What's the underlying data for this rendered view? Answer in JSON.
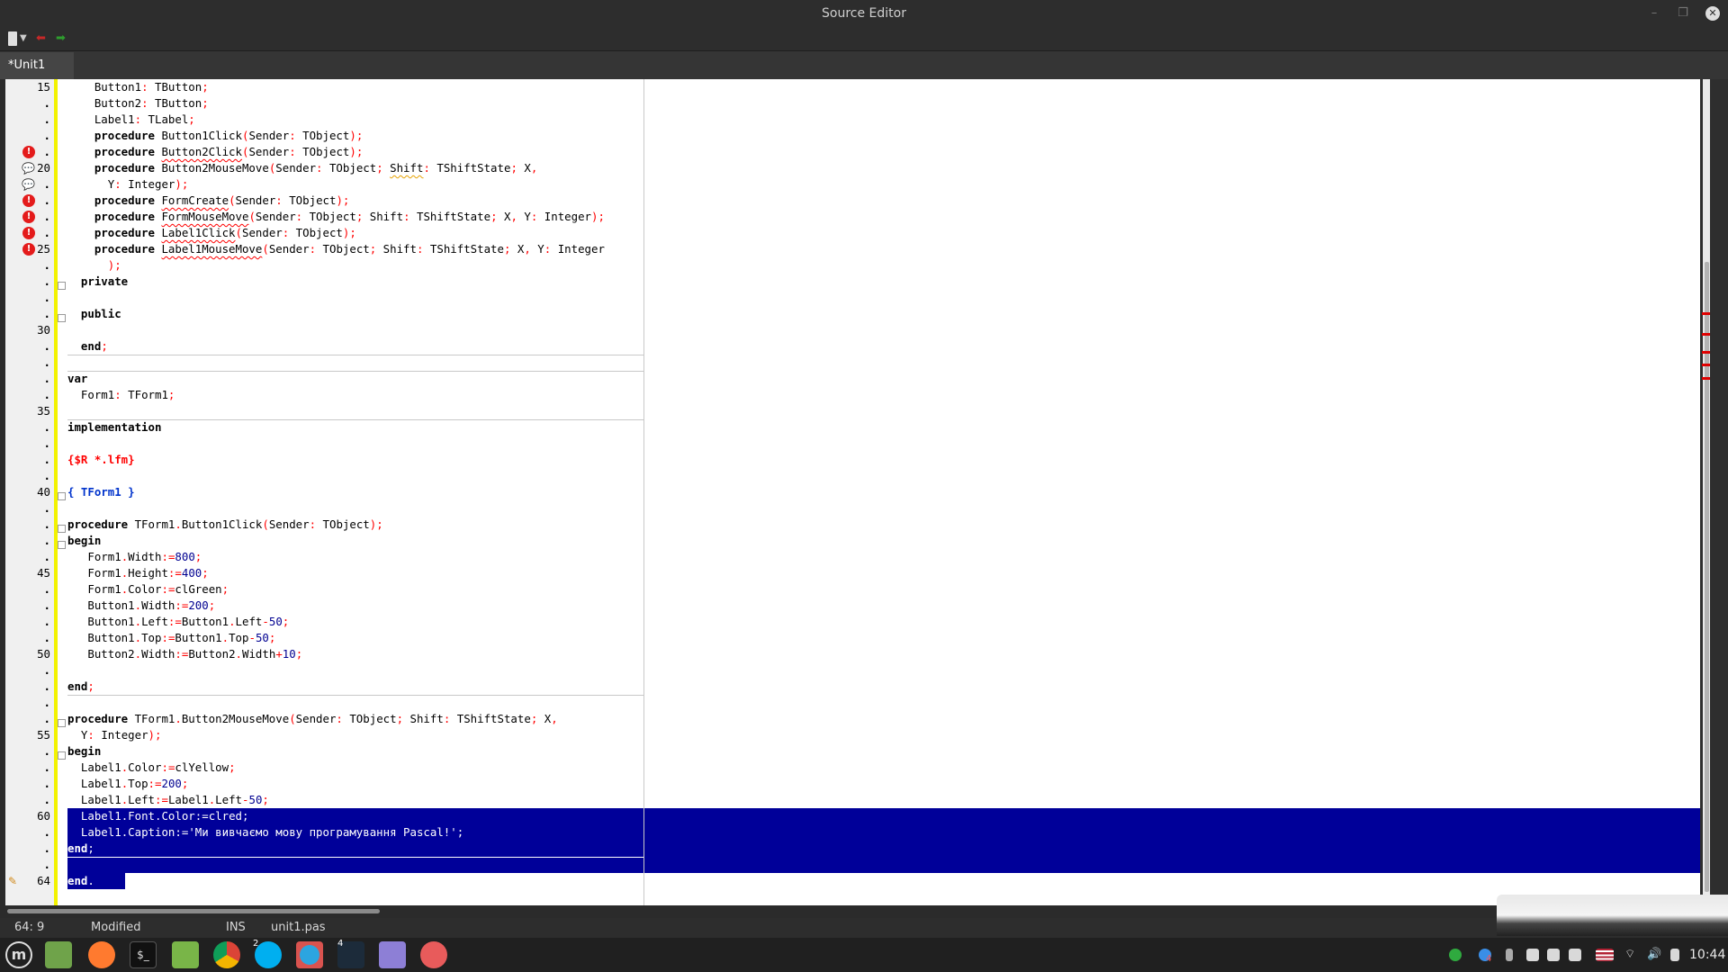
{
  "window": {
    "title": "Source Editor"
  },
  "tabs": [
    {
      "label": "*Unit1",
      "active": true
    }
  ],
  "status": {
    "cursor": "64:  9",
    "state": "Modified",
    "mode": "INS",
    "file": "unit1.pas"
  },
  "taskbar": {
    "clock": "10:44",
    "skype_badge": "2",
    "paw_badge": "4",
    "chrome_badge": "4"
  },
  "colors": {
    "selection": "#000099",
    "keyword": "#000000",
    "symbol": "#ff0000",
    "number": "#000090",
    "directive": "#ff0000",
    "comment": "#0033cc",
    "change_bar": "#f2f200"
  },
  "editor": {
    "lines": [
      {
        "num": "15",
        "text": "    Button1: TButton;"
      },
      {
        "num": ".",
        "text": "    Button2: TButton;"
      },
      {
        "num": ".",
        "text": "    Label1: TLabel;"
      },
      {
        "num": ".",
        "text": "    procedure Button1Click(Sender: TObject);"
      },
      {
        "num": ".",
        "text": "    procedure Button2Click(Sender: TObject);",
        "icon": "error-icon"
      },
      {
        "num": "20",
        "text": "    procedure Button2MouseMove(Sender: TObject; Shift: TShiftState; X,",
        "icon": "hint-icon"
      },
      {
        "num": ".",
        "text": "      Y: Integer);",
        "icon": "hint-icon"
      },
      {
        "num": ".",
        "text": "    procedure FormCreate(Sender: TObject);",
        "icon": "error-icon"
      },
      {
        "num": ".",
        "text": "    procedure FormMouseMove(Sender: TObject; Shift: TShiftState; X, Y: Integer);",
        "icon": "error-icon"
      },
      {
        "num": ".",
        "text": "    procedure Label1Click(Sender: TObject);",
        "icon": "error-icon"
      },
      {
        "num": "25",
        "text": "    procedure Label1MouseMove(Sender: TObject; Shift: TShiftState; X, Y: Integer",
        "icon": "error-icon"
      },
      {
        "num": ".",
        "text": "      );"
      },
      {
        "num": ".",
        "text": "  private"
      },
      {
        "num": ".",
        "text": ""
      },
      {
        "num": ".",
        "text": "  public"
      },
      {
        "num": "30",
        "text": ""
      },
      {
        "num": ".",
        "text": "  end;"
      },
      {
        "num": ".",
        "text": ""
      },
      {
        "num": ".",
        "text": "var"
      },
      {
        "num": ".",
        "text": "  Form1: TForm1;"
      },
      {
        "num": "35",
        "text": ""
      },
      {
        "num": ".",
        "text": "implementation"
      },
      {
        "num": ".",
        "text": ""
      },
      {
        "num": ".",
        "text": "{$R *.lfm}"
      },
      {
        "num": ".",
        "text": ""
      },
      {
        "num": "40",
        "text": "{ TForm1 }"
      },
      {
        "num": ".",
        "text": ""
      },
      {
        "num": ".",
        "text": "procedure TForm1.Button1Click(Sender: TObject);"
      },
      {
        "num": ".",
        "text": "begin"
      },
      {
        "num": ".",
        "text": "   Form1.Width:=800;"
      },
      {
        "num": "45",
        "text": "   Form1.Height:=400;"
      },
      {
        "num": ".",
        "text": "   Form1.Color:=clGreen;"
      },
      {
        "num": ".",
        "text": "   Button1.Width:=200;"
      },
      {
        "num": ".",
        "text": "   Button1.Left:=Button1.Left-50;"
      },
      {
        "num": ".",
        "text": "   Button1.Top:=Button1.Top-50;"
      },
      {
        "num": "50",
        "text": "   Button2.Width:=Button2.Width+10;"
      },
      {
        "num": ".",
        "text": ""
      },
      {
        "num": ".",
        "text": "end;"
      },
      {
        "num": ".",
        "text": ""
      },
      {
        "num": ".",
        "text": "procedure TForm1.Button2MouseMove(Sender: TObject; Shift: TShiftState; X,"
      },
      {
        "num": "55",
        "text": "  Y: Integer);"
      },
      {
        "num": ".",
        "text": "begin"
      },
      {
        "num": ".",
        "text": "  Label1.Color:=clYellow;"
      },
      {
        "num": ".",
        "text": "  Label1.Top:=200;"
      },
      {
        "num": ".",
        "text": "  Label1.Left:=Label1.Left-50;"
      },
      {
        "num": "60",
        "text": "  Label1.Font.Color:=clred;",
        "selected": true
      },
      {
        "num": ".",
        "text": "  Label1.Caption:='Ми вивчаємо мову програмування Pascal!';",
        "selected": true
      },
      {
        "num": ".",
        "text": "end;",
        "selected": true
      },
      {
        "num": ".",
        "text": "",
        "selected": true
      },
      {
        "num": "64",
        "text": "end.",
        "selected_partial": true,
        "icon": "edit-icon"
      }
    ]
  }
}
